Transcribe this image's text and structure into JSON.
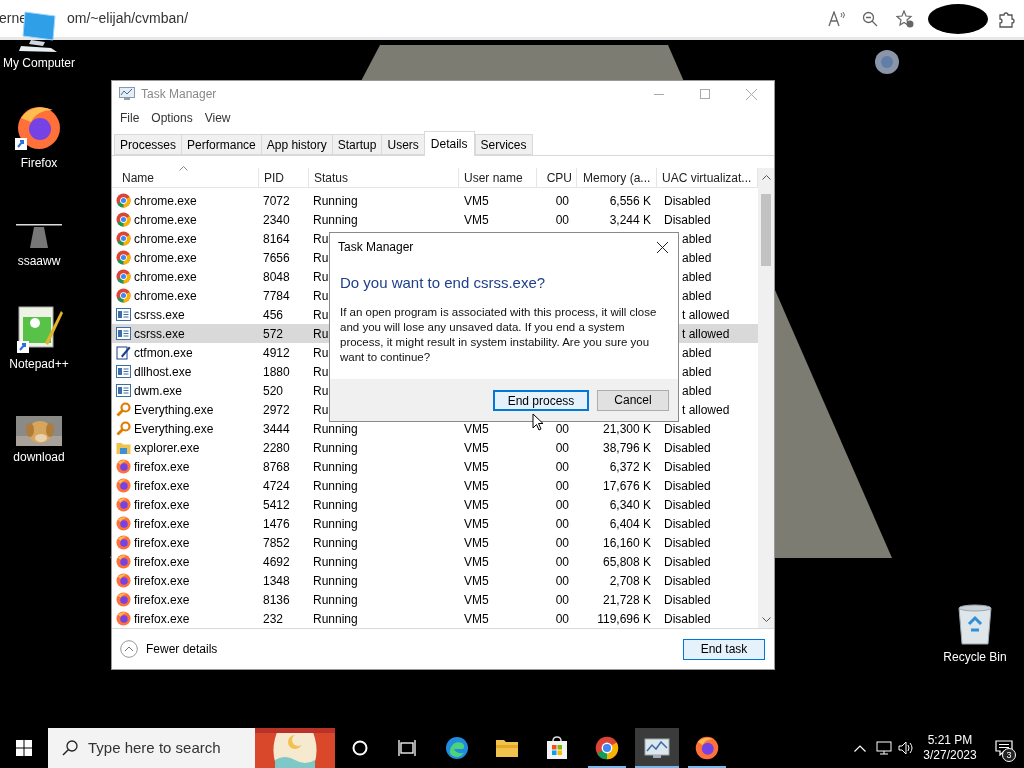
{
  "browser_toolbar": {
    "url_start": "erne",
    "url_end": "om/~elijah/cvmban/"
  },
  "desktop_icons": [
    {
      "kind": "computer",
      "label": "My Computer"
    },
    {
      "kind": "firefox",
      "label": "Firefox"
    },
    {
      "kind": "shortcut-image",
      "label": "ssaaww"
    },
    {
      "kind": "notepad",
      "label": "Notepad++"
    },
    {
      "label": "download"
    },
    {
      "kind": "recycle",
      "label": "Recycle Bin"
    }
  ],
  "task_manager": {
    "title": "Task Manager",
    "menu": [
      "File",
      "Options",
      "View"
    ],
    "tabs": [
      {
        "label": "Processes",
        "selected": false
      },
      {
        "label": "Performance",
        "selected": false
      },
      {
        "label": "App history",
        "selected": false
      },
      {
        "label": "Startup",
        "selected": false
      },
      {
        "label": "Users",
        "selected": false
      },
      {
        "label": "Details",
        "selected": true
      },
      {
        "label": "Services",
        "selected": false
      }
    ],
    "columns": [
      "Name",
      "PID",
      "Status",
      "User name",
      "CPU",
      "Memory (a...",
      "UAC virtualizat..."
    ],
    "rows": [
      {
        "kind": "chrome",
        "name": "chrome.exe",
        "pid": "7072",
        "status": "Running",
        "user": "VM5",
        "cpu": "00",
        "memory": "6,556 K",
        "uac": "Disabled",
        "selected": false
      },
      {
        "kind": "chrome",
        "name": "chrome.exe",
        "pid": "2340",
        "status": "Running",
        "user": "VM5",
        "cpu": "00",
        "memory": "3,244 K",
        "uac": "Disabled",
        "selected": false
      },
      {
        "kind": "chrome",
        "name": "chrome.exe",
        "pid": "8164",
        "status": "Ru",
        "uac": "abled",
        "selected": false
      },
      {
        "kind": "chrome",
        "name": "chrome.exe",
        "pid": "7656",
        "status": "Ru",
        "uac": "abled",
        "selected": false
      },
      {
        "kind": "chrome",
        "name": "chrome.exe",
        "pid": "8048",
        "status": "Ru",
        "uac": "abled",
        "selected": false
      },
      {
        "kind": "chrome",
        "name": "chrome.exe",
        "pid": "7784",
        "status": "Ru",
        "uac": "abled",
        "selected": false
      },
      {
        "kind": "window",
        "name": "csrss.exe",
        "pid": "456",
        "status": "Ru",
        "uac": "t allowed",
        "selected": false
      },
      {
        "kind": "window",
        "name": "csrss.exe",
        "pid": "572",
        "status": "Ru",
        "uac": "t allowed",
        "selected": true
      },
      {
        "kind": "pen",
        "name": "ctfmon.exe",
        "pid": "4912",
        "status": "Ru",
        "uac": "abled",
        "selected": false
      },
      {
        "kind": "window",
        "name": "dllhost.exe",
        "pid": "1880",
        "status": "Ru",
        "uac": "abled",
        "selected": false
      },
      {
        "kind": "window",
        "name": "dwm.exe",
        "pid": "520",
        "status": "Ru",
        "uac": "abled",
        "selected": false
      },
      {
        "kind": "magnifier",
        "name": "Everything.exe",
        "pid": "2972",
        "status": "Ru",
        "uac": "t allowed",
        "selected": false
      },
      {
        "kind": "magnifier",
        "name": "Everything.exe",
        "pid": "3444",
        "status": "Running",
        "user": "VM5",
        "cpu": "00",
        "memory": "21,300 K",
        "uac": "Disabled",
        "selected": false
      },
      {
        "kind": "folder",
        "name": "explorer.exe",
        "pid": "2280",
        "status": "Running",
        "user": "VM5",
        "cpu": "00",
        "memory": "38,796 K",
        "uac": "Disabled",
        "selected": false
      },
      {
        "kind": "firefox",
        "name": "firefox.exe",
        "pid": "8768",
        "status": "Running",
        "user": "VM5",
        "cpu": "00",
        "memory": "6,372 K",
        "uac": "Disabled",
        "selected": false
      },
      {
        "kind": "firefox",
        "name": "firefox.exe",
        "pid": "4724",
        "status": "Running",
        "user": "VM5",
        "cpu": "00",
        "memory": "17,676 K",
        "uac": "Disabled",
        "selected": false
      },
      {
        "kind": "firefox",
        "name": "firefox.exe",
        "pid": "5412",
        "status": "Running",
        "user": "VM5",
        "cpu": "00",
        "memory": "6,340 K",
        "uac": "Disabled",
        "selected": false
      },
      {
        "kind": "firefox",
        "name": "firefox.exe",
        "pid": "1476",
        "status": "Running",
        "user": "VM5",
        "cpu": "00",
        "memory": "6,404 K",
        "uac": "Disabled",
        "selected": false
      },
      {
        "kind": "firefox",
        "name": "firefox.exe",
        "pid": "7852",
        "status": "Running",
        "user": "VM5",
        "cpu": "00",
        "memory": "16,160 K",
        "uac": "Disabled",
        "selected": false
      },
      {
        "kind": "firefox",
        "name": "firefox.exe",
        "pid": "4692",
        "status": "Running",
        "user": "VM5",
        "cpu": "00",
        "memory": "65,808 K",
        "uac": "Disabled",
        "selected": false
      },
      {
        "kind": "firefox",
        "name": "firefox.exe",
        "pid": "1348",
        "status": "Running",
        "user": "VM5",
        "cpu": "00",
        "memory": "2,708 K",
        "uac": "Disabled",
        "selected": false
      },
      {
        "kind": "firefox",
        "name": "firefox.exe",
        "pid": "8136",
        "status": "Running",
        "user": "VM5",
        "cpu": "00",
        "memory": "21,728 K",
        "uac": "Disabled",
        "selected": false
      },
      {
        "kind": "firefox",
        "name": "firefox.exe",
        "pid": "232",
        "status": "Running",
        "user": "VM5",
        "cpu": "00",
        "memory": "119,696 K",
        "uac": "Disabled",
        "selected": false
      }
    ],
    "fewer_details": "Fewer details",
    "end_task": "End task"
  },
  "dialog": {
    "title": "Task Manager",
    "heading": "Do you want to end csrss.exe?",
    "body": "If an open program is associated with this process, it will close and you will lose any unsaved data. If you end a system process, it might result in system instability. Are you sure you want to continue?",
    "buttons": [
      {
        "label": "End process",
        "focused": true
      },
      {
        "label": "Cancel",
        "focused": false
      }
    ]
  },
  "taskbar": {
    "search_placeholder": "Type here to search",
    "apps": [
      {
        "kind": "edge",
        "running": false,
        "active": false
      },
      {
        "kind": "explorer",
        "running": false,
        "active": false
      },
      {
        "kind": "store",
        "running": false,
        "active": false
      },
      {
        "kind": "chrome",
        "running": true,
        "active": false
      },
      {
        "kind": "taskmgr",
        "running": true,
        "active": true
      },
      {
        "kind": "firefox",
        "running": true,
        "active": false
      }
    ],
    "time": "5:21 PM",
    "date": "3/27/2023",
    "notification_count": "3"
  }
}
